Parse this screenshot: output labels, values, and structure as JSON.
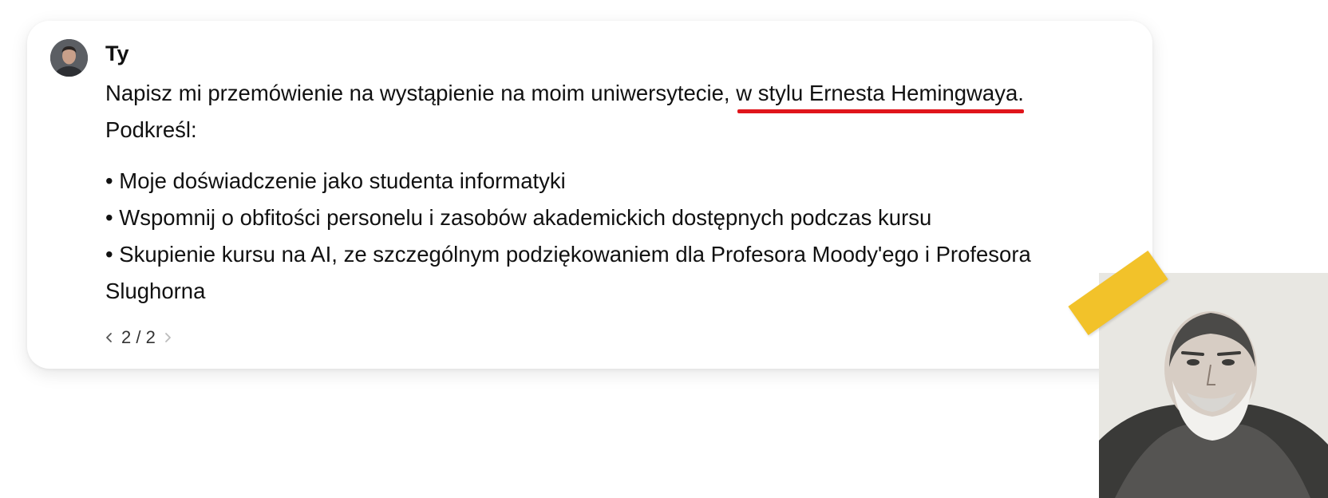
{
  "message": {
    "author": "Ty",
    "line1_prefix": "Napisz mi przemówienie na wystąpienie na moim uniwersytecie, ",
    "line1_highlight": "w stylu Ernesta Hemingwaya.",
    "line2": "Podkreśl:",
    "bullets": [
      "Moje doświadczenie jako studenta informatyki",
      "Wspomnij o obfitości personelu i zasobów akademickich dostępnych podczas kursu",
      "Skupienie kursu na AI, ze szczególnym podziękowaniem dla Profesora Moody'ego i Profesora Slughorna"
    ],
    "highlight_color": "#e0151b"
  },
  "pager": {
    "label": "2 / 2"
  },
  "icons": {
    "avatar": "user-avatar",
    "prev": "chevron-left-icon",
    "next": "chevron-right-icon",
    "photo": "hemingway-portrait",
    "tape": "yellow-tape"
  }
}
